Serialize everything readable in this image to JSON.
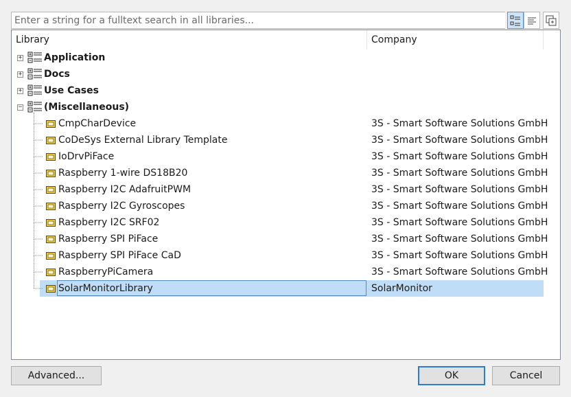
{
  "search": {
    "placeholder": "Enter a string for a fulltext search in all libraries..."
  },
  "toolbar": {
    "category_view_icon": "category-view-icon",
    "flat_view_icon": "flat-list-icon",
    "expand_icon": "copy-expand-icon"
  },
  "columns": {
    "library": "Library",
    "company": "Company"
  },
  "categories": [
    {
      "name": "Application",
      "expanded": false
    },
    {
      "name": "Docs",
      "expanded": false
    },
    {
      "name": "Use Cases",
      "expanded": false
    },
    {
      "name": "(Miscellaneous)",
      "expanded": true
    }
  ],
  "libraries": [
    {
      "name": "CmpCharDevice",
      "company": "3S - Smart Software Solutions GmbH"
    },
    {
      "name": "CoDeSys External Library Template",
      "company": "3S - Smart Software Solutions GmbH"
    },
    {
      "name": "IoDrvPiFace",
      "company": "3S - Smart Software Solutions GmbH"
    },
    {
      "name": "Raspberry 1-wire DS18B20",
      "company": "3S - Smart Software Solutions GmbH"
    },
    {
      "name": "Raspberry I2C AdafruitPWM",
      "company": "3S - Smart Software Solutions GmbH"
    },
    {
      "name": "Raspberry I2C Gyroscopes",
      "company": "3S - Smart Software Solutions GmbH"
    },
    {
      "name": "Raspberry I2C SRF02",
      "company": "3S - Smart Software Solutions GmbH"
    },
    {
      "name": "Raspberry SPI PiFace",
      "company": "3S - Smart Software Solutions GmbH"
    },
    {
      "name": "Raspberry SPI PiFace CaD",
      "company": "3S - Smart Software Solutions GmbH"
    },
    {
      "name": "RaspberryPiCamera",
      "company": "3S - Smart Software Solutions GmbH"
    },
    {
      "name": "SolarMonitorLibrary",
      "company": "SolarMonitor",
      "selected": true
    }
  ],
  "buttons": {
    "advanced": "Advanced...",
    "ok": "OK",
    "cancel": "Cancel"
  },
  "colors": {
    "selection": "#bfddf6",
    "selection_border": "#5289c4",
    "default_button_border": "#2b7bd0"
  }
}
